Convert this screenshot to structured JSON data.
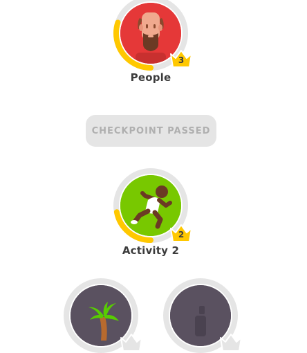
{
  "skills": [
    {
      "name": "People",
      "crown_level": "3",
      "progress": 0.3,
      "color": "#e53838",
      "icon": "man-face-icon"
    },
    {
      "name": "Activity 2",
      "crown_level": "2",
      "progress": 0.22,
      "color": "#78c800",
      "icon": "running-person-icon"
    },
    {
      "name": "",
      "crown_level": "",
      "progress": 0,
      "color": "#5a5160",
      "icon": "palm-tree-icon"
    },
    {
      "name": "",
      "crown_level": "",
      "progress": 0,
      "color": "#5a5160",
      "icon": "locked-figure-icon"
    }
  ],
  "checkpoint": {
    "label": "CHECKPOINT PASSED"
  },
  "colors": {
    "ring_track": "#e5e5e5",
    "ring_progress": "#ffc800",
    "crown_gold": "#ffc800",
    "crown_locked": "#e5e5e5",
    "label_text": "#3c3c3c",
    "checkpoint_bg": "#e5e5e5",
    "checkpoint_text": "#afafaf"
  }
}
